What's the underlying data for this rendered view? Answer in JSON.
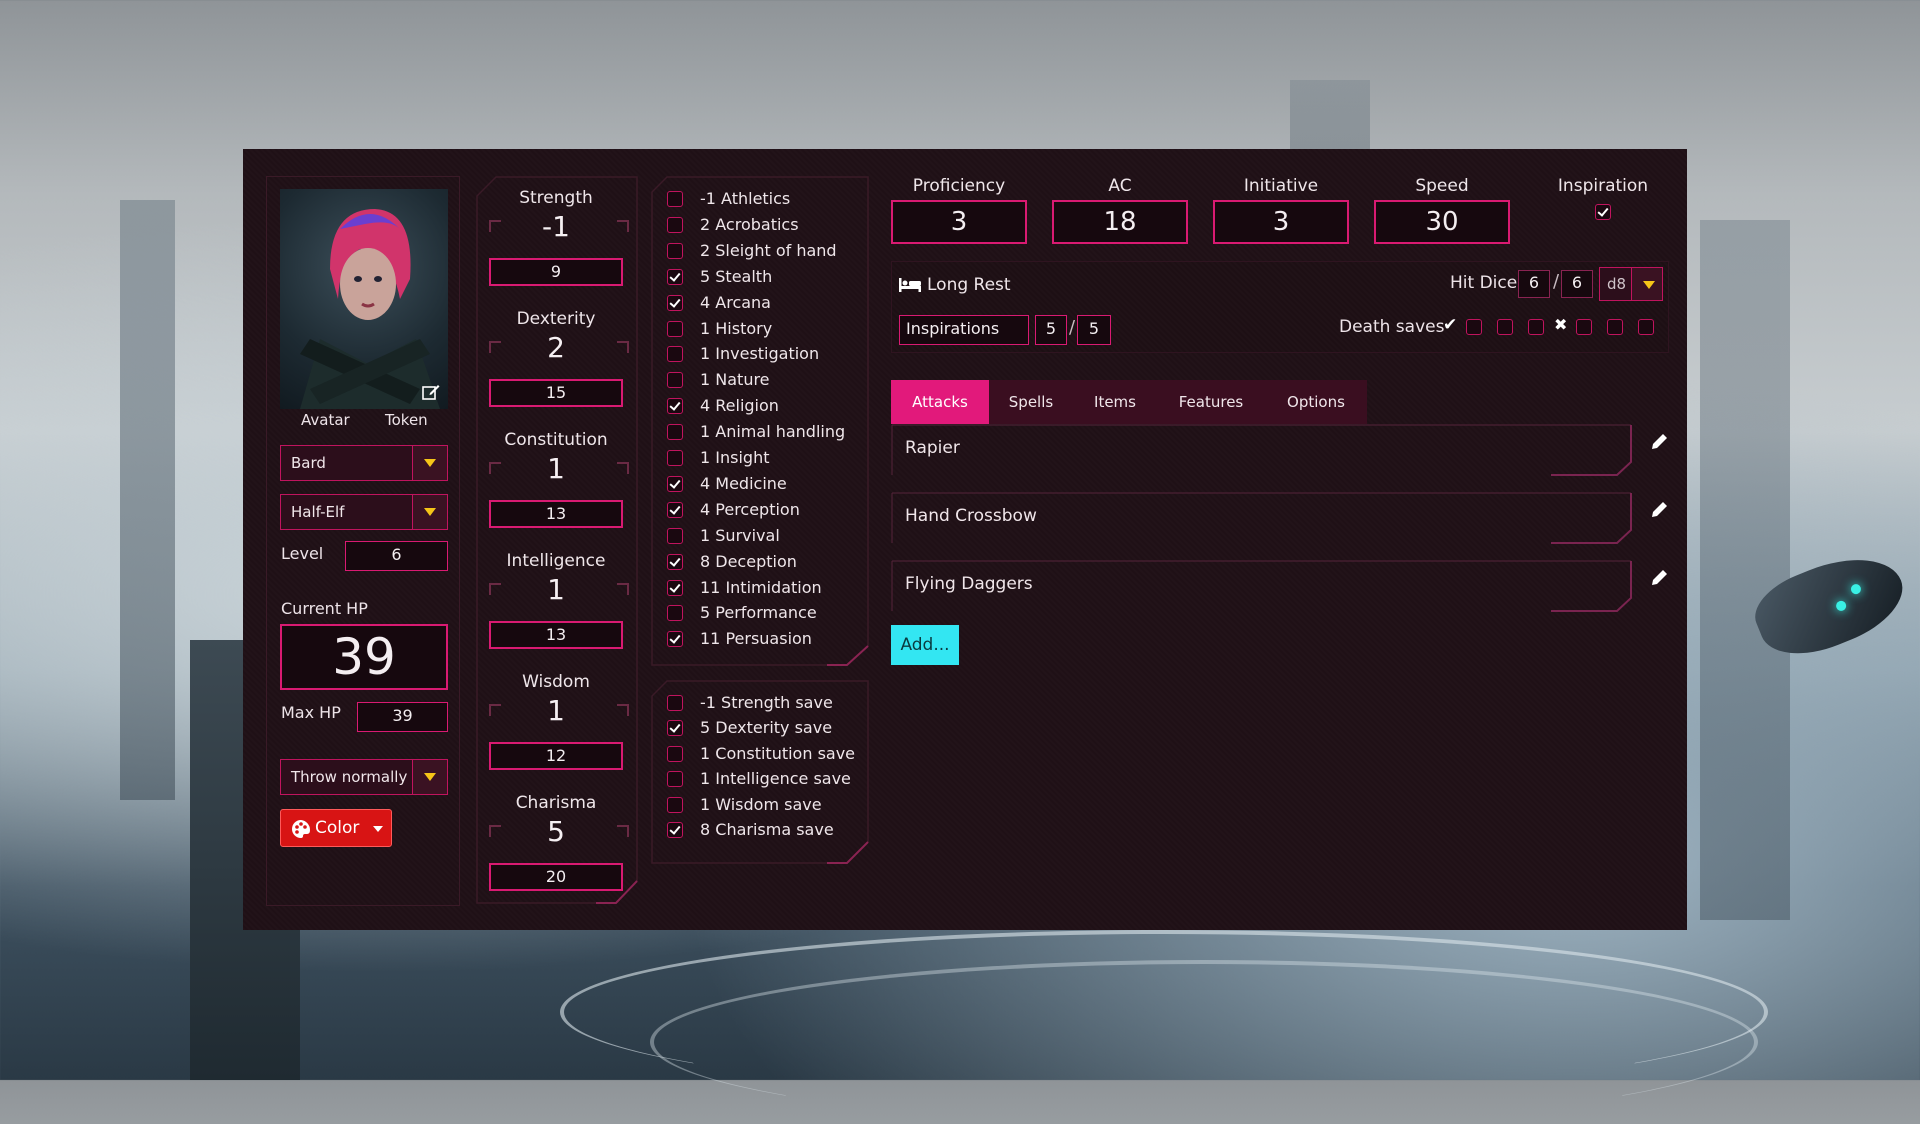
{
  "character": {
    "avatar_tab": "Avatar",
    "token_tab": "Token",
    "class": "Bard",
    "race": "Half-Elf",
    "level_label": "Level",
    "level": "6",
    "current_hp_label": "Current HP",
    "current_hp": "39",
    "max_hp_label": "Max HP",
    "max_hp": "39",
    "throw_mode": "Throw normally",
    "color_button": "Color"
  },
  "abilities": [
    {
      "name": "Strength",
      "mod": "-1",
      "score": "9"
    },
    {
      "name": "Dexterity",
      "mod": "2",
      "score": "15"
    },
    {
      "name": "Constitution",
      "mod": "1",
      "score": "13"
    },
    {
      "name": "Intelligence",
      "mod": "1",
      "score": "13"
    },
    {
      "name": "Wisdom",
      "mod": "1",
      "score": "12"
    },
    {
      "name": "Charisma",
      "mod": "5",
      "score": "20"
    }
  ],
  "skills": [
    {
      "label": "-1 Athletics",
      "checked": false
    },
    {
      "label": "2 Acrobatics",
      "checked": false
    },
    {
      "label": "2 Sleight of hand",
      "checked": false
    },
    {
      "label": "5 Stealth",
      "checked": true
    },
    {
      "label": "4 Arcana",
      "checked": true
    },
    {
      "label": "1 History",
      "checked": false
    },
    {
      "label": "1 Investigation",
      "checked": false
    },
    {
      "label": "1 Nature",
      "checked": false
    },
    {
      "label": "4 Religion",
      "checked": true
    },
    {
      "label": "1 Animal handling",
      "checked": false
    },
    {
      "label": "1 Insight",
      "checked": false
    },
    {
      "label": "4 Medicine",
      "checked": true
    },
    {
      "label": "4 Perception",
      "checked": true
    },
    {
      "label": "1 Survival",
      "checked": false
    },
    {
      "label": "8 Deception",
      "checked": true
    },
    {
      "label": "11 Intimidation",
      "checked": true
    },
    {
      "label": "5 Performance",
      "checked": false
    },
    {
      "label": "11 Persuasion",
      "checked": true
    }
  ],
  "saves": [
    {
      "label": "-1 Strength save",
      "checked": false
    },
    {
      "label": "5 Dexterity save",
      "checked": true
    },
    {
      "label": "1 Constitution save",
      "checked": false
    },
    {
      "label": "1 Intelligence save",
      "checked": false
    },
    {
      "label": "1 Wisdom save",
      "checked": false
    },
    {
      "label": "8 Charisma save",
      "checked": true
    }
  ],
  "stats": {
    "proficiency_label": "Proficiency",
    "proficiency": "3",
    "ac_label": "AC",
    "ac": "18",
    "initiative_label": "Initiative",
    "initiative": "3",
    "speed_label": "Speed",
    "speed": "30",
    "inspiration_label": "Inspiration",
    "inspiration_checked": true
  },
  "rest": {
    "long_rest": "Long Rest",
    "hit_dice_label": "Hit Dice",
    "hit_dice_current": "6",
    "separator": "/",
    "hit_dice_max": "6",
    "hit_die": "d8",
    "inspirations_label": "Inspirations",
    "inspirations_current": "5",
    "inspirations_max": "5",
    "death_saves_label": "Death saves",
    "success_symbol": "✔",
    "failure_symbol": "✖"
  },
  "tabs": [
    "Attacks",
    "Spells",
    "Items",
    "Features",
    "Options"
  ],
  "active_tab": "Attacks",
  "attacks": [
    "Rapier",
    "Hand Crossbow",
    "Flying Daggers"
  ],
  "add_button": "Add...",
  "colors": {
    "accent": "#e2197b",
    "border": "#d91a72",
    "panel_bg": "#1f1016",
    "add_button": "#33e6f2",
    "color_button": "#d81414",
    "dropdown_arrow": "#f5c518"
  },
  "icons": {
    "edit_avatar": "edit-icon",
    "long_rest": "bed-icon",
    "attack_edit": "pencil-icon",
    "color": "palette-icon"
  }
}
